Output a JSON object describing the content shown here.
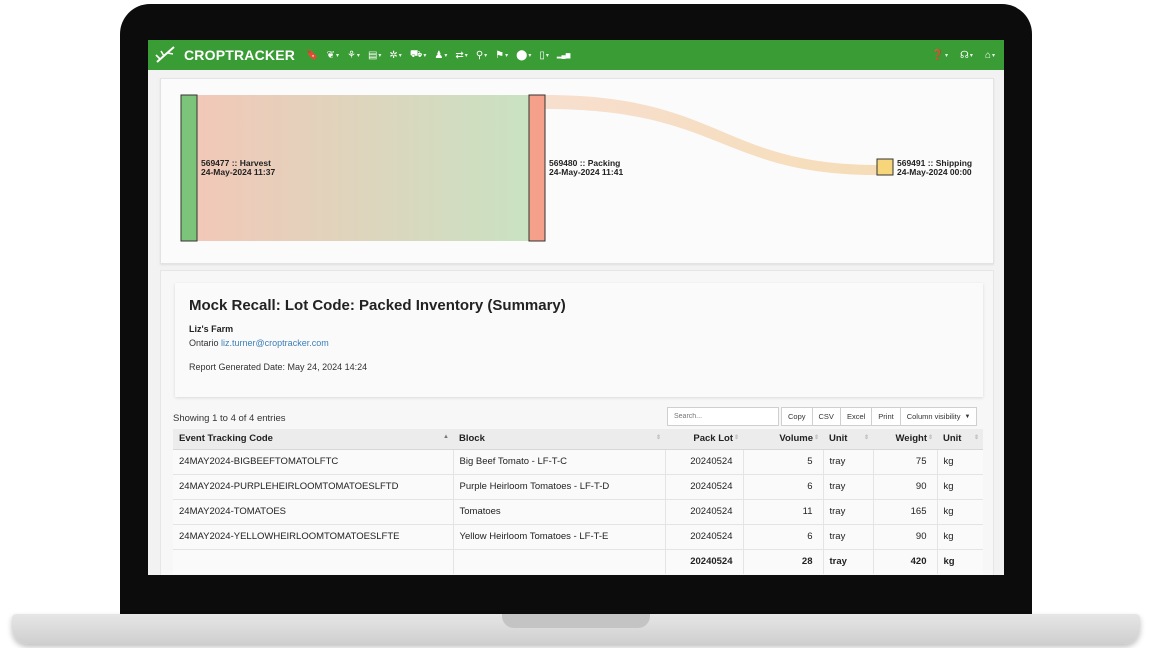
{
  "app": {
    "brand": "CROPTRACKER"
  },
  "navbar": {
    "icons": [
      {
        "name": "bookmark-icon",
        "glyph": "🔖"
      },
      {
        "name": "leaf-icon",
        "glyph": "❦"
      },
      {
        "name": "seedling-icon",
        "glyph": "⚘"
      },
      {
        "name": "clipboard-icon",
        "glyph": "▤"
      },
      {
        "name": "gear-icon",
        "glyph": "✲"
      },
      {
        "name": "truck-icon",
        "glyph": "⛟"
      },
      {
        "name": "person-icon",
        "glyph": "♟"
      },
      {
        "name": "exchange-icon",
        "glyph": "⇄"
      },
      {
        "name": "bulb-icon",
        "glyph": "⚲"
      },
      {
        "name": "flag-icon",
        "glyph": "⚑"
      },
      {
        "name": "pin-icon",
        "glyph": "⬤"
      },
      {
        "name": "mobile-icon",
        "glyph": "▯"
      },
      {
        "name": "bar-chart-icon",
        "glyph": "▂▄▆"
      }
    ],
    "right_icons": [
      {
        "name": "help-icon",
        "glyph": "❓"
      },
      {
        "name": "support-icon",
        "glyph": "☊"
      },
      {
        "name": "building-icon",
        "glyph": "⌂"
      }
    ]
  },
  "sankey": {
    "nodes": [
      {
        "id": "569477 :: Harvest",
        "date": "24-May-2024 11:37",
        "color": "#7cc47a"
      },
      {
        "id": "569480 :: Packing",
        "date": "24-May-2024 11:41",
        "color": "#f5a08a"
      },
      {
        "id": "569491 :: Shipping",
        "date": "24-May-2024 00:00",
        "color": "#f7d57a"
      }
    ]
  },
  "report": {
    "title": "Mock Recall: Lot Code: Packed Inventory (Summary)",
    "farm_name": "Liz's Farm",
    "province": "Ontario",
    "email": "liz.turner@croptracker.com",
    "generated": "Report Generated Date: May 24, 2024 14:24"
  },
  "table": {
    "showing": "Showing 1 to 4 of 4 entries",
    "search_placeholder": "Search...",
    "buttons": [
      "Copy",
      "CSV",
      "Excel",
      "Print",
      "Column visibility"
    ],
    "headers": [
      "Event Tracking Code",
      "Block",
      "Pack Lot",
      "Volume",
      "Unit",
      "Weight",
      "Unit"
    ],
    "rows": [
      {
        "code": "24MAY2024-BIGBEEFTOMATOLFTC",
        "block": "Big Beef Tomato - LF-T-C",
        "lot": "20240524",
        "volume": "5",
        "vunit": "tray",
        "weight": "75",
        "wunit": "kg"
      },
      {
        "code": "24MAY2024-PURPLEHEIRLOOMTOMATOESLFTD",
        "block": "Purple Heirloom Tomatoes - LF-T-D",
        "lot": "20240524",
        "volume": "6",
        "vunit": "tray",
        "weight": "90",
        "wunit": "kg"
      },
      {
        "code": "24MAY2024-TOMATOES",
        "block": "Tomatoes",
        "lot": "20240524",
        "volume": "11",
        "vunit": "tray",
        "weight": "165",
        "wunit": "kg"
      },
      {
        "code": "24MAY2024-YELLOWHEIRLOOMTOMATOESLFTE",
        "block": "Yellow Heirloom Tomatoes - LF-T-E",
        "lot": "20240524",
        "volume": "6",
        "vunit": "tray",
        "weight": "90",
        "wunit": "kg"
      }
    ],
    "total": {
      "lot": "20240524",
      "volume": "28",
      "vunit": "tray",
      "weight": "420",
      "wunit": "kg"
    }
  }
}
